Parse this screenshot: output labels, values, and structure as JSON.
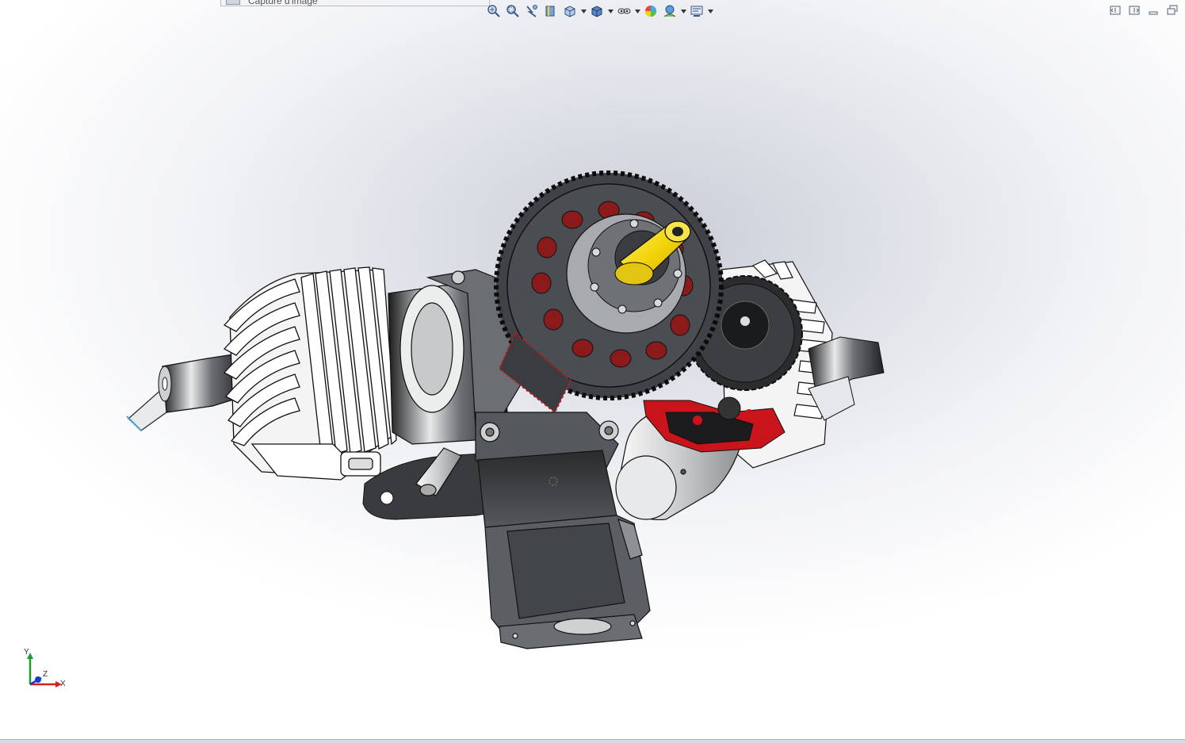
{
  "window": {
    "tab_title": "Capture d'image"
  },
  "heads_up_toolbar": {
    "buttons": [
      {
        "name": "zoom-to-fit-icon",
        "dropdown": false
      },
      {
        "name": "zoom-to-area-icon",
        "dropdown": false
      },
      {
        "name": "previous-view-icon",
        "dropdown": false
      },
      {
        "name": "section-view-icon",
        "dropdown": false
      },
      {
        "name": "view-orientation-icon",
        "dropdown": true
      },
      {
        "name": "display-style-icon",
        "dropdown": true
      },
      {
        "name": "hide-show-items-icon",
        "dropdown": true
      },
      {
        "name": "edit-appearance-icon",
        "dropdown": false
      },
      {
        "name": "apply-scene-icon",
        "dropdown": true
      },
      {
        "name": "view-settings-icon",
        "dropdown": true
      }
    ]
  },
  "window_controls": [
    "tile-horizontal-icon",
    "tile-vertical-icon",
    "minimize-icon",
    "restore-icon"
  ],
  "triad": {
    "y_label": "Y",
    "z_label": "Z",
    "x_label": "X"
  },
  "colors": {
    "gear_dark": "#3f4247",
    "shaft_yellow": "#f2d40a",
    "red_bracket": "#c8141a",
    "metal_light": "#e6e7ea",
    "triad_x": "#d42020",
    "triad_y": "#1e9a2a",
    "triad_z": "#1a3ccc"
  }
}
